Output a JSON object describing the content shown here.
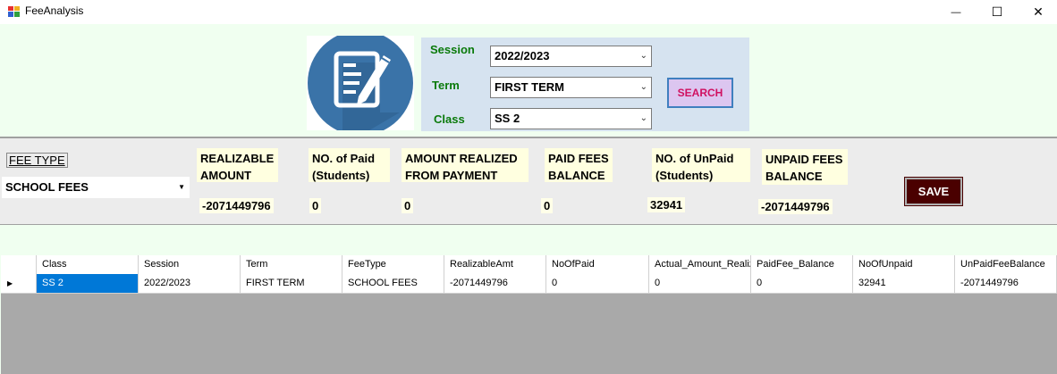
{
  "window": {
    "title": "FeeAnalysis",
    "minimize_glyph": "—",
    "maximize_glyph": "☐",
    "close_glyph": "✕"
  },
  "filters": {
    "session_label": "Session",
    "session_value": "2022/2023",
    "term_label": "Term",
    "term_value": "FIRST TERM",
    "class_label": "Class",
    "class_value": "SS 2",
    "search_label": "SEARCH"
  },
  "summary": {
    "fee_type_label": "FEE TYPE",
    "fee_type_value": "SCHOOL FEES",
    "realizable_amount_label": "REALIZABLE\nAMOUNT",
    "realizable_amount_value": "-2071449796",
    "no_paid_label": "NO. of Paid\n(Students)",
    "no_paid_value": "0",
    "amount_realized_label": "AMOUNT REALIZED\nFROM PAYMENT",
    "amount_realized_value": "0",
    "paid_balance_label": "PAID FEES\nBALANCE",
    "paid_balance_value": "0",
    "no_unpaid_label": "NO. of UnPaid\n(Students)",
    "no_unpaid_value": "32941",
    "unpaid_balance_label": "UNPAID FEES\nBALANCE",
    "unpaid_balance_value": "-2071449796",
    "save_label": "SAVE"
  },
  "grid": {
    "columns": [
      "Class",
      "Session",
      "Term",
      "FeeType",
      "RealizableAmt",
      "NoOfPaid",
      "Actual_Amount_Realiz",
      "PaidFee_Balance",
      "NoOfUnpaid",
      "UnPaidFeeBalance"
    ],
    "rows": [
      [
        "SS 2",
        "2022/2023",
        "FIRST TERM",
        "SCHOOL FEES",
        "-2071449796",
        "0",
        "0",
        "0",
        "32941",
        "-2071449796"
      ]
    ]
  },
  "colors": {
    "background": "#f0fff0",
    "filter_panel": "#d6e3f0",
    "label_green": "#0a7a0a",
    "header_yellow": "#ffffe0",
    "save_button": "#4a0000",
    "search_text": "#d01060",
    "selection": "#0078d7",
    "grid_empty": "#a9a9a9"
  }
}
